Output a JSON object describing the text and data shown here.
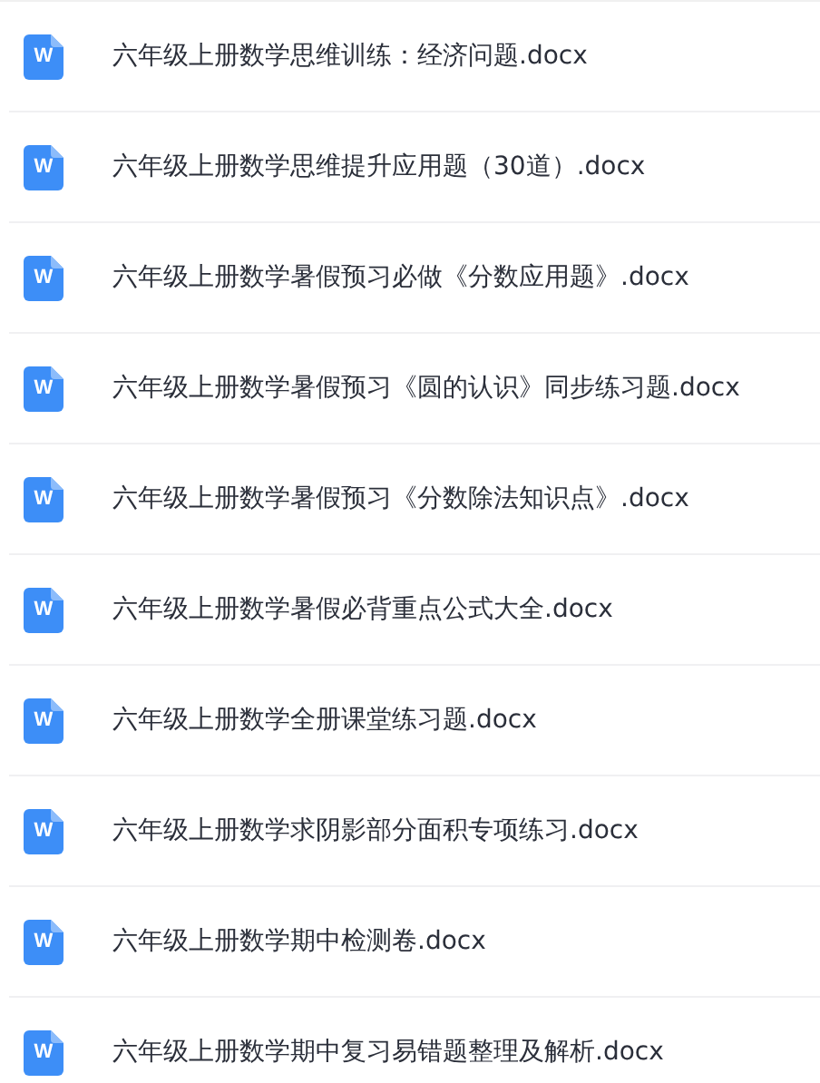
{
  "files": [
    {
      "icon_glyph": "W",
      "name": "六年级上册数学思维训练：经济问题.docx"
    },
    {
      "icon_glyph": "W",
      "name": "六年级上册数学思维提升应用题（30道）.docx"
    },
    {
      "icon_glyph": "W",
      "name": "六年级上册数学暑假预习必做《分数应用题》.docx"
    },
    {
      "icon_glyph": "W",
      "name": "六年级上册数学暑假预习《圆的认识》同步练习题.docx"
    },
    {
      "icon_glyph": "W",
      "name": "六年级上册数学暑假预习《分数除法知识点》.docx"
    },
    {
      "icon_glyph": "W",
      "name": "六年级上册数学暑假必背重点公式大全.docx"
    },
    {
      "icon_glyph": "W",
      "name": "六年级上册数学全册课堂练习题.docx"
    },
    {
      "icon_glyph": "W",
      "name": "六年级上册数学求阴影部分面积专项练习.docx"
    },
    {
      "icon_glyph": "W",
      "name": "六年级上册数学期中检测卷.docx"
    },
    {
      "icon_glyph": "W",
      "name": "六年级上册数学期中复习易错题整理及解析.docx"
    }
  ]
}
